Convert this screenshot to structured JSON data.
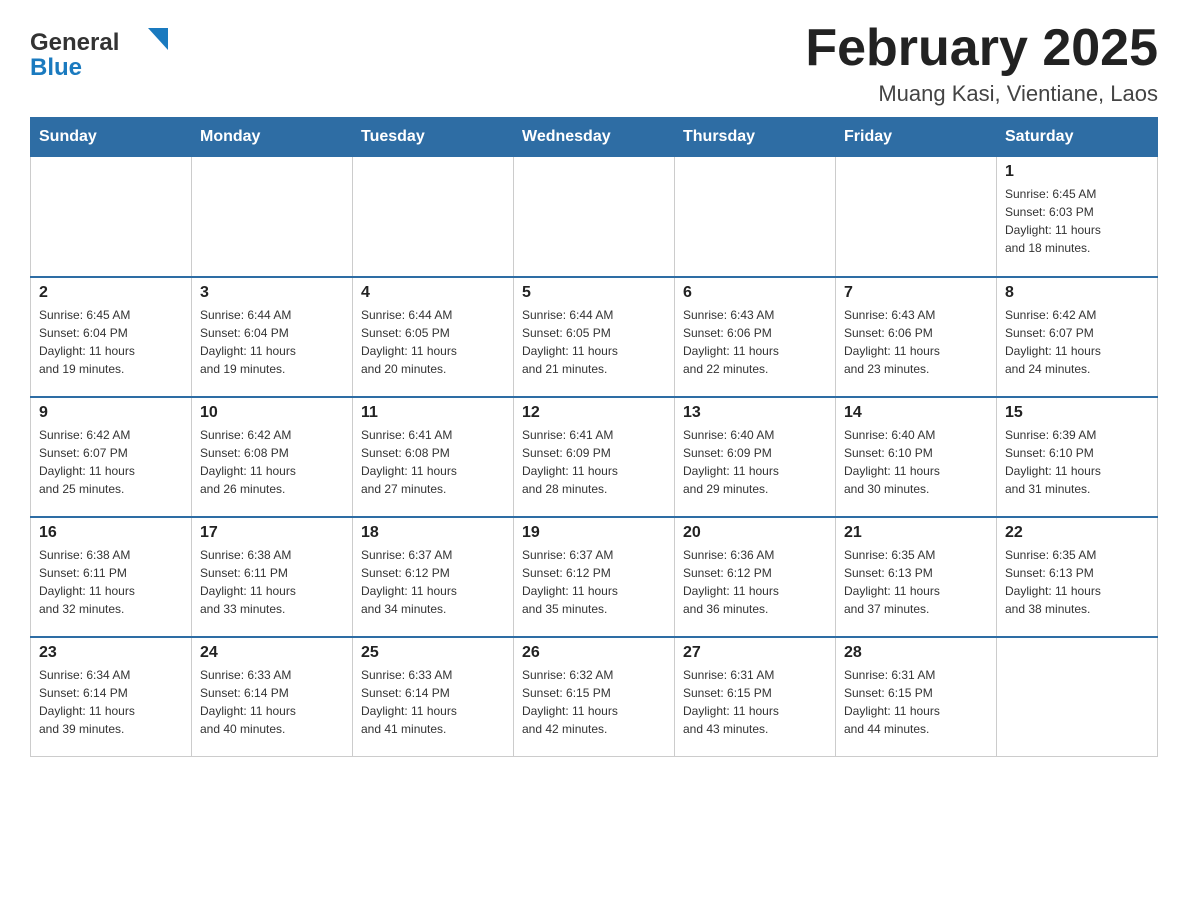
{
  "header": {
    "logo_general": "General",
    "logo_blue": "Blue",
    "title": "February 2025",
    "subtitle": "Muang Kasi, Vientiane, Laos"
  },
  "weekdays": [
    "Sunday",
    "Monday",
    "Tuesday",
    "Wednesday",
    "Thursday",
    "Friday",
    "Saturday"
  ],
  "weeks": [
    [
      {
        "day": "",
        "info": ""
      },
      {
        "day": "",
        "info": ""
      },
      {
        "day": "",
        "info": ""
      },
      {
        "day": "",
        "info": ""
      },
      {
        "day": "",
        "info": ""
      },
      {
        "day": "",
        "info": ""
      },
      {
        "day": "1",
        "info": "Sunrise: 6:45 AM\nSunset: 6:03 PM\nDaylight: 11 hours\nand 18 minutes."
      }
    ],
    [
      {
        "day": "2",
        "info": "Sunrise: 6:45 AM\nSunset: 6:04 PM\nDaylight: 11 hours\nand 19 minutes."
      },
      {
        "day": "3",
        "info": "Sunrise: 6:44 AM\nSunset: 6:04 PM\nDaylight: 11 hours\nand 19 minutes."
      },
      {
        "day": "4",
        "info": "Sunrise: 6:44 AM\nSunset: 6:05 PM\nDaylight: 11 hours\nand 20 minutes."
      },
      {
        "day": "5",
        "info": "Sunrise: 6:44 AM\nSunset: 6:05 PM\nDaylight: 11 hours\nand 21 minutes."
      },
      {
        "day": "6",
        "info": "Sunrise: 6:43 AM\nSunset: 6:06 PM\nDaylight: 11 hours\nand 22 minutes."
      },
      {
        "day": "7",
        "info": "Sunrise: 6:43 AM\nSunset: 6:06 PM\nDaylight: 11 hours\nand 23 minutes."
      },
      {
        "day": "8",
        "info": "Sunrise: 6:42 AM\nSunset: 6:07 PM\nDaylight: 11 hours\nand 24 minutes."
      }
    ],
    [
      {
        "day": "9",
        "info": "Sunrise: 6:42 AM\nSunset: 6:07 PM\nDaylight: 11 hours\nand 25 minutes."
      },
      {
        "day": "10",
        "info": "Sunrise: 6:42 AM\nSunset: 6:08 PM\nDaylight: 11 hours\nand 26 minutes."
      },
      {
        "day": "11",
        "info": "Sunrise: 6:41 AM\nSunset: 6:08 PM\nDaylight: 11 hours\nand 27 minutes."
      },
      {
        "day": "12",
        "info": "Sunrise: 6:41 AM\nSunset: 6:09 PM\nDaylight: 11 hours\nand 28 minutes."
      },
      {
        "day": "13",
        "info": "Sunrise: 6:40 AM\nSunset: 6:09 PM\nDaylight: 11 hours\nand 29 minutes."
      },
      {
        "day": "14",
        "info": "Sunrise: 6:40 AM\nSunset: 6:10 PM\nDaylight: 11 hours\nand 30 minutes."
      },
      {
        "day": "15",
        "info": "Sunrise: 6:39 AM\nSunset: 6:10 PM\nDaylight: 11 hours\nand 31 minutes."
      }
    ],
    [
      {
        "day": "16",
        "info": "Sunrise: 6:38 AM\nSunset: 6:11 PM\nDaylight: 11 hours\nand 32 minutes."
      },
      {
        "day": "17",
        "info": "Sunrise: 6:38 AM\nSunset: 6:11 PM\nDaylight: 11 hours\nand 33 minutes."
      },
      {
        "day": "18",
        "info": "Sunrise: 6:37 AM\nSunset: 6:12 PM\nDaylight: 11 hours\nand 34 minutes."
      },
      {
        "day": "19",
        "info": "Sunrise: 6:37 AM\nSunset: 6:12 PM\nDaylight: 11 hours\nand 35 minutes."
      },
      {
        "day": "20",
        "info": "Sunrise: 6:36 AM\nSunset: 6:12 PM\nDaylight: 11 hours\nand 36 minutes."
      },
      {
        "day": "21",
        "info": "Sunrise: 6:35 AM\nSunset: 6:13 PM\nDaylight: 11 hours\nand 37 minutes."
      },
      {
        "day": "22",
        "info": "Sunrise: 6:35 AM\nSunset: 6:13 PM\nDaylight: 11 hours\nand 38 minutes."
      }
    ],
    [
      {
        "day": "23",
        "info": "Sunrise: 6:34 AM\nSunset: 6:14 PM\nDaylight: 11 hours\nand 39 minutes."
      },
      {
        "day": "24",
        "info": "Sunrise: 6:33 AM\nSunset: 6:14 PM\nDaylight: 11 hours\nand 40 minutes."
      },
      {
        "day": "25",
        "info": "Sunrise: 6:33 AM\nSunset: 6:14 PM\nDaylight: 11 hours\nand 41 minutes."
      },
      {
        "day": "26",
        "info": "Sunrise: 6:32 AM\nSunset: 6:15 PM\nDaylight: 11 hours\nand 42 minutes."
      },
      {
        "day": "27",
        "info": "Sunrise: 6:31 AM\nSunset: 6:15 PM\nDaylight: 11 hours\nand 43 minutes."
      },
      {
        "day": "28",
        "info": "Sunrise: 6:31 AM\nSunset: 6:15 PM\nDaylight: 11 hours\nand 44 minutes."
      },
      {
        "day": "",
        "info": ""
      }
    ]
  ]
}
